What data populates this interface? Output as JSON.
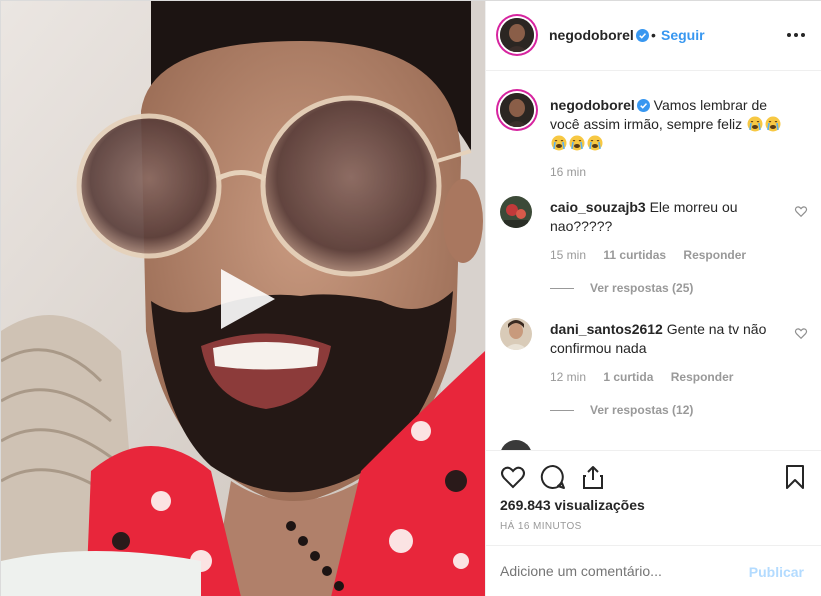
{
  "post": {
    "username": "negodoborel",
    "follow_label": "Seguir",
    "dot": "•",
    "caption": "Vamos lembrar de você assim irmão, sempre feliz",
    "caption_time": "16 min"
  },
  "comments": [
    {
      "username": "caio_souzajb3",
      "text": "Ele morreu ou nao?????",
      "time": "15 min",
      "likes": "11 curtidas",
      "reply_label": "Responder",
      "view_replies": "Ver respostas (25)"
    },
    {
      "username": "dani_santos2612",
      "text": "Gente na tv não confirmou nada",
      "time": "12 min",
      "likes": "1 curtida",
      "reply_label": "Responder",
      "view_replies": "Ver respostas (12)"
    }
  ],
  "stats": {
    "views": "269.843 visualizações",
    "posted_ago": "HÁ 16 MINUTOS"
  },
  "comment_box": {
    "placeholder": "Adicione um comentário...",
    "publish_label": "Publicar"
  },
  "colors": {
    "accent": "#3897f0",
    "publish_disabled": "#b3dbff",
    "meta_gray": "#999999",
    "shirt_red": "#e8263b"
  },
  "icons": [
    "play-icon",
    "verified-badge-icon",
    "more-options-icon",
    "heart-icon",
    "comment-icon",
    "share-icon",
    "bookmark-icon",
    "crying-emoji-icon"
  ]
}
